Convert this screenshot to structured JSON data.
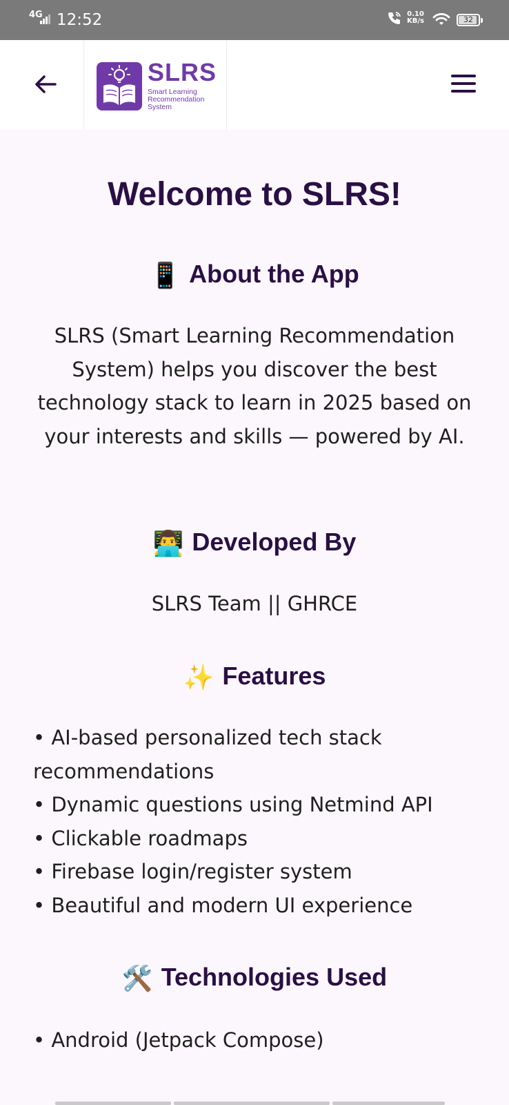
{
  "status_bar": {
    "network": "4G",
    "time": "12:52",
    "speed_value": "0.10",
    "speed_unit": "KB/s",
    "battery": "32"
  },
  "app_bar": {
    "logo_title": "SLRS",
    "logo_subtitle": "Smart Learning Recommendation System",
    "back_icon": "arrow-back-icon",
    "menu_icon": "hamburger-menu-icon"
  },
  "main": {
    "title": "Welcome to SLRS!",
    "about": {
      "emoji": "📱",
      "heading": "About the App",
      "text": "SLRS (Smart Learning Recommendation System) helps you discover the best technology stack to learn in 2025 based on your interests and skills — powered by AI."
    },
    "developed": {
      "emoji": "👨‍💻",
      "heading": "Developed By",
      "text": "SLRS Team || GHRCE"
    },
    "features": {
      "emoji": "✨",
      "heading": "Features",
      "items": [
        "• AI-based personalized tech stack recommendations",
        "• Dynamic questions using Netmind API",
        "• Clickable roadmaps",
        "• Firebase login/register system",
        "• Beautiful and modern UI experience"
      ]
    },
    "technologies": {
      "emoji": "🛠️",
      "heading": "Technologies Used",
      "items": [
        "• Android (Jetpack Compose)"
      ]
    }
  },
  "colors": {
    "primary": "#6f3aa8",
    "heading": "#2a0f45",
    "background": "#fcf7fc",
    "status_bar": "#7a7a7a"
  }
}
